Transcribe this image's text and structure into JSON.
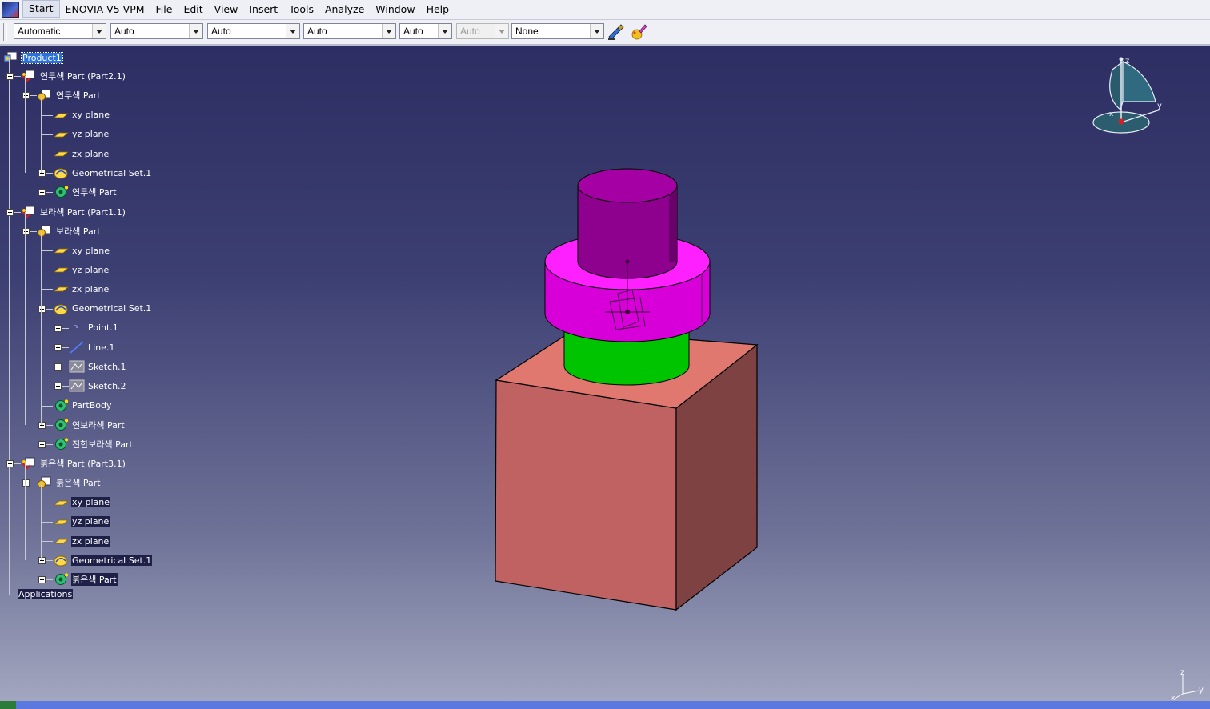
{
  "menubar": {
    "items": [
      "Start",
      "ENOVIA V5 VPM",
      "File",
      "Edit",
      "View",
      "Insert",
      "Tools",
      "Analyze",
      "Window",
      "Help"
    ],
    "active": "Start"
  },
  "toolbar": {
    "combos": [
      {
        "value": "Automatic",
        "enabled": true
      },
      {
        "value": "Auto",
        "enabled": true
      },
      {
        "value": "Auto",
        "enabled": true
      },
      {
        "value": "Auto",
        "enabled": true
      },
      {
        "value": "Auto",
        "enabled": true
      },
      {
        "value": "Auto",
        "enabled": false
      },
      {
        "value": "None",
        "enabled": true
      }
    ],
    "icons": [
      "paintbrush-icon",
      "properties-painter-icon"
    ]
  },
  "tree": {
    "root": "Product1",
    "nodes": [
      {
        "label": "연두색 Part (Part2.1)",
        "icon": "product-part-icon"
      },
      {
        "label": "연두색 Part",
        "icon": "part-icon"
      },
      {
        "label": "xy plane",
        "icon": "plane-icon"
      },
      {
        "label": "yz plane",
        "icon": "plane-icon"
      },
      {
        "label": "zx plane",
        "icon": "plane-icon"
      },
      {
        "label": "Geometrical Set.1",
        "icon": "geometrical-set-icon"
      },
      {
        "label": "연두색 Part",
        "icon": "body-icon"
      },
      {
        "label": "보라색 Part (Part1.1)",
        "icon": "product-part-icon"
      },
      {
        "label": "보라색 Part",
        "icon": "part-icon"
      },
      {
        "label": "xy plane",
        "icon": "plane-icon"
      },
      {
        "label": "yz plane",
        "icon": "plane-icon"
      },
      {
        "label": "zx plane",
        "icon": "plane-icon"
      },
      {
        "label": "Geometrical Set.1",
        "icon": "geometrical-set-icon"
      },
      {
        "label": "Point.1",
        "icon": "point-icon"
      },
      {
        "label": "Line.1",
        "icon": "line-icon"
      },
      {
        "label": "Sketch.1",
        "icon": "sketch-icon"
      },
      {
        "label": "Sketch.2",
        "icon": "sketch-icon"
      },
      {
        "label": "PartBody",
        "icon": "body-icon"
      },
      {
        "label": "연보라색 Part",
        "icon": "body-icon"
      },
      {
        "label": "진한보라색 Part",
        "icon": "body-icon"
      },
      {
        "label": "붉은색 Part (Part3.1)",
        "icon": "product-part-icon"
      },
      {
        "label": "붉은색 Part",
        "icon": "part-icon"
      },
      {
        "label": "xy plane",
        "icon": "plane-icon"
      },
      {
        "label": "yz plane",
        "icon": "plane-icon"
      },
      {
        "label": "zx plane",
        "icon": "plane-icon"
      },
      {
        "label": "Geometrical Set.1",
        "icon": "geometrical-set-icon"
      },
      {
        "label": "붉은색 Part",
        "icon": "body-icon"
      }
    ],
    "applications": "Applications"
  },
  "compass": {
    "x_label": "x",
    "y_label": "y",
    "z_label": "z"
  },
  "axis_mini": {
    "x_label": "x",
    "y_label": "y",
    "z_label": "z"
  },
  "colors": {
    "box": "#c06262",
    "green_cylinder": "#00c800",
    "magenta_ring": "#e400e4",
    "purple_cylinder": "#a000a0",
    "selection": "#2a72d8"
  }
}
